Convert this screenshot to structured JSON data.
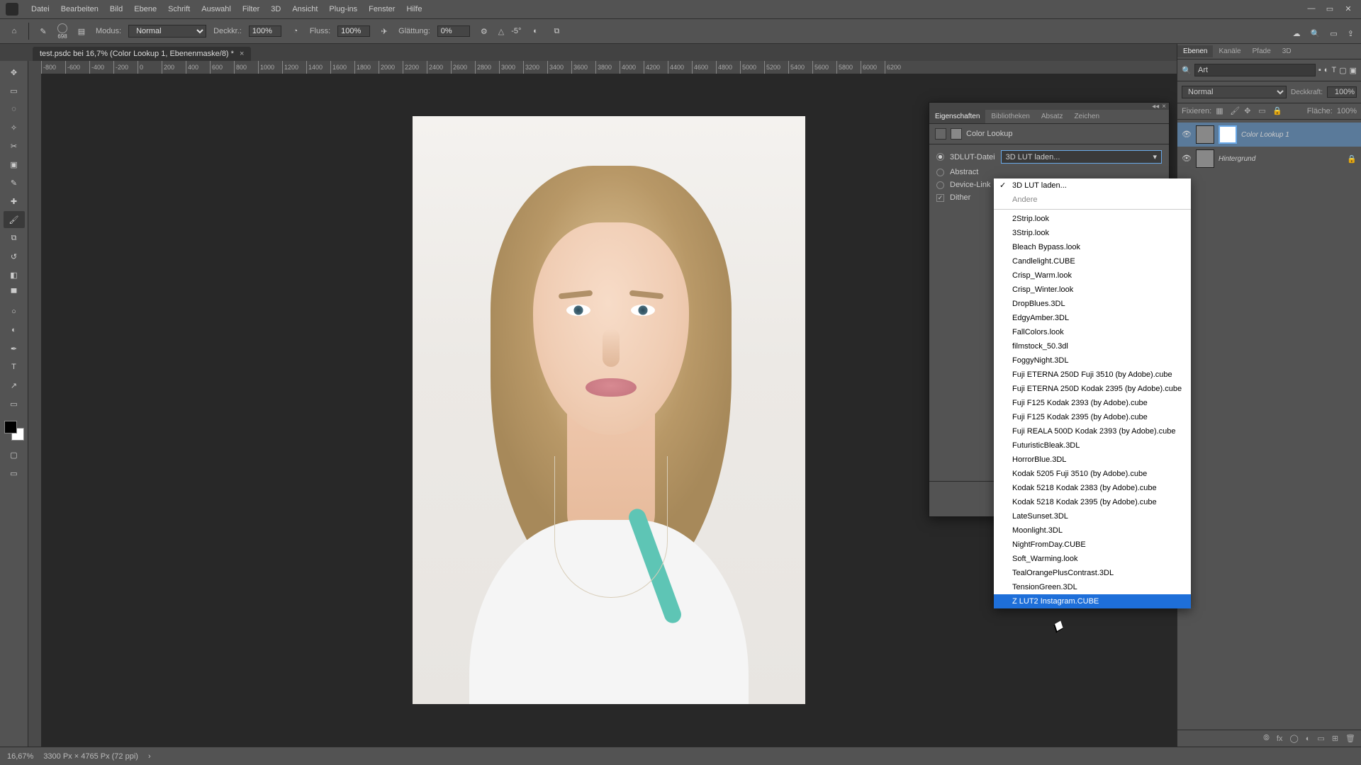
{
  "menu": {
    "items": [
      "Datei",
      "Bearbeiten",
      "Bild",
      "Ebene",
      "Schrift",
      "Auswahl",
      "Filter",
      "3D",
      "Ansicht",
      "Plug-ins",
      "Fenster",
      "Hilfe"
    ]
  },
  "options": {
    "size_label": "698",
    "mode_label": "Modus:",
    "mode_value": "Normal",
    "opacity_label": "Deckkr.:",
    "opacity_value": "100%",
    "flow_label": "Fluss:",
    "flow_value": "100%",
    "smoothing_label": "Glättung:",
    "smoothing_value": "0%",
    "angle_label": "△",
    "angle_value": "-5°"
  },
  "tab": {
    "title": "test.psdc bei 16,7% (Color Lookup 1, Ebenenmaske/8) *"
  },
  "ruler_ticks": [
    "-800",
    "-600",
    "-400",
    "-200",
    "0",
    "200",
    "400",
    "600",
    "800",
    "1000",
    "1200",
    "1400",
    "1600",
    "1800",
    "2000",
    "2200",
    "2400",
    "2600",
    "2800",
    "3000",
    "3200",
    "3400",
    "3600",
    "3800",
    "4000",
    "4200",
    "4400",
    "4600",
    "4800",
    "5000",
    "5200",
    "5400",
    "5600",
    "5800",
    "6000",
    "6200"
  ],
  "panels_right": {
    "tabs": [
      "Ebenen",
      "Kanäle",
      "Pfade",
      "3D"
    ],
    "search_placeholder": "Art",
    "blend_mode": "Normal",
    "opacity_label": "Deckkraft:",
    "opacity_value": "100%",
    "lock_label": "Fixieren:",
    "fill_label": "Fläche:",
    "fill_value": "100%",
    "layers": [
      {
        "name": "Color Lookup 1",
        "selected": true,
        "has_mask": true
      },
      {
        "name": "Hintergrund",
        "selected": false,
        "locked": true
      }
    ]
  },
  "properties": {
    "tabs": [
      "Eigenschaften",
      "Bibliotheken",
      "Absatz",
      "Zeichen"
    ],
    "title": "Color Lookup",
    "row1_label": "3DLUT-Datei",
    "row1_value": "3D LUT laden...",
    "row2_label": "Abstract",
    "row3_label": "Device-Link",
    "dither_label": "Dither"
  },
  "dropdown": {
    "checked": "3D LUT laden...",
    "other": "Andere",
    "items": [
      "2Strip.look",
      "3Strip.look",
      "Bleach Bypass.look",
      "Candlelight.CUBE",
      "Crisp_Warm.look",
      "Crisp_Winter.look",
      "DropBlues.3DL",
      "EdgyAmber.3DL",
      "FallColors.look",
      "filmstock_50.3dl",
      "FoggyNight.3DL",
      "Fuji ETERNA 250D Fuji 3510 (by Adobe).cube",
      "Fuji ETERNA 250D Kodak 2395 (by Adobe).cube",
      "Fuji F125 Kodak 2393 (by Adobe).cube",
      "Fuji F125 Kodak 2395 (by Adobe).cube",
      "Fuji REALA 500D Kodak 2393 (by Adobe).cube",
      "FuturisticBleak.3DL",
      "HorrorBlue.3DL",
      "Kodak 5205 Fuji 3510 (by Adobe).cube",
      "Kodak 5218 Kodak 2383 (by Adobe).cube",
      "Kodak 5218 Kodak 2395 (by Adobe).cube",
      "LateSunset.3DL",
      "Moonlight.3DL",
      "NightFromDay.CUBE",
      "Soft_Warming.look",
      "TealOrangePlusContrast.3DL",
      "TensionGreen.3DL"
    ],
    "highlighted": "Z LUT2 Instagram.CUBE"
  },
  "status": {
    "zoom": "16,67%",
    "info": "3300 Px × 4765 Px (72 ppi)"
  }
}
